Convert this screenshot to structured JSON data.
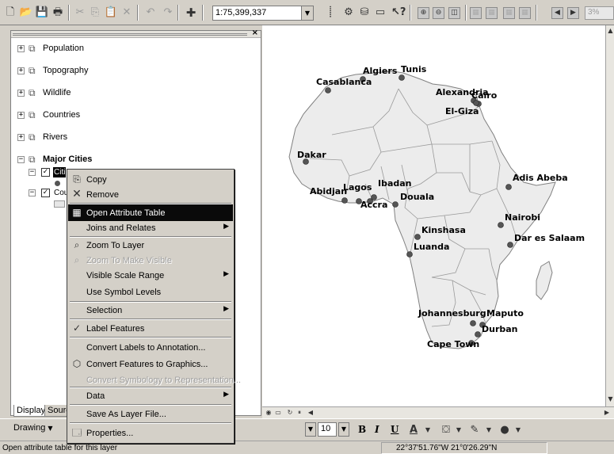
{
  "toolbar": {
    "scale": "1:75,399,337",
    "zoom_percent": "3%",
    "icons": [
      "new-document-icon",
      "open-folder-icon",
      "save-icon",
      "print-icon",
      "cut-icon",
      "copy-icon",
      "paste-icon",
      "delete-icon",
      "undo-icon",
      "redo-icon",
      "add-data-icon",
      "editor-icon",
      "arctoolbox-icon",
      "catalog-icon",
      "window-icon",
      "whats-this-icon",
      "layout-zoom-icons"
    ]
  },
  "toc": {
    "layers": [
      {
        "label": "Population"
      },
      {
        "label": "Topography"
      },
      {
        "label": "Wildlife"
      },
      {
        "label": "Countries"
      },
      {
        "label": "Rivers"
      },
      {
        "label": "Major Cities"
      }
    ],
    "sublayers": [
      {
        "label": "Citi"
      },
      {
        "label": "Cou"
      }
    ],
    "tabs": {
      "display": "Display",
      "source": "Sourc"
    }
  },
  "context_menu": {
    "items": [
      {
        "label": "Copy",
        "icon": "copy-icon"
      },
      {
        "label": "Remove",
        "icon": "remove-icon"
      },
      {
        "label": "Open Attribute Table",
        "icon": "table-icon"
      },
      {
        "label": "Joins and Relates"
      },
      {
        "label": "Zoom To Layer",
        "icon": "zoom-to-layer-icon"
      },
      {
        "label": "Zoom To Make Visible",
        "icon": "zoom-visible-icon"
      },
      {
        "label": "Visible Scale Range"
      },
      {
        "label": "Use Symbol Levels"
      },
      {
        "label": "Selection"
      },
      {
        "label": "Label Features",
        "icon": "checkmark-icon"
      },
      {
        "label": "Convert Labels to Annotation..."
      },
      {
        "label": "Convert Features to Graphics...",
        "icon": "convert-graphics-icon"
      },
      {
        "label": "Convert Symbology to Representation..."
      },
      {
        "label": "Data"
      },
      {
        "label": "Save As Layer File..."
      },
      {
        "label": "Properties...",
        "icon": "properties-icon"
      }
    ]
  },
  "map": {
    "cities": [
      {
        "name": "Algiers"
      },
      {
        "name": "Tunis"
      },
      {
        "name": "Casablanca"
      },
      {
        "name": "Alexandria"
      },
      {
        "name": "Cairo"
      },
      {
        "name": "El-Giza"
      },
      {
        "name": "Dakar"
      },
      {
        "name": "Adis Abeba"
      },
      {
        "name": "Ibadan"
      },
      {
        "name": "Lagos"
      },
      {
        "name": "Abidjan"
      },
      {
        "name": "Douala"
      },
      {
        "name": "Accra"
      },
      {
        "name": "Nairobi"
      },
      {
        "name": "Kinshasa"
      },
      {
        "name": "Dar es Salaam"
      },
      {
        "name": "Luanda"
      },
      {
        "name": "Johannesburg"
      },
      {
        "name": "Maputo"
      },
      {
        "name": "Durban"
      },
      {
        "name": "Cape Town"
      }
    ]
  },
  "drawbar": {
    "drawing_menu": "Drawing",
    "font_size": "10",
    "bold": "B",
    "italic": "I",
    "underline": "U"
  },
  "statusbar": {
    "message": "Open attribute table for this layer",
    "coordinates": "22°37'51.76\"W  21°0'26.29\"N"
  }
}
